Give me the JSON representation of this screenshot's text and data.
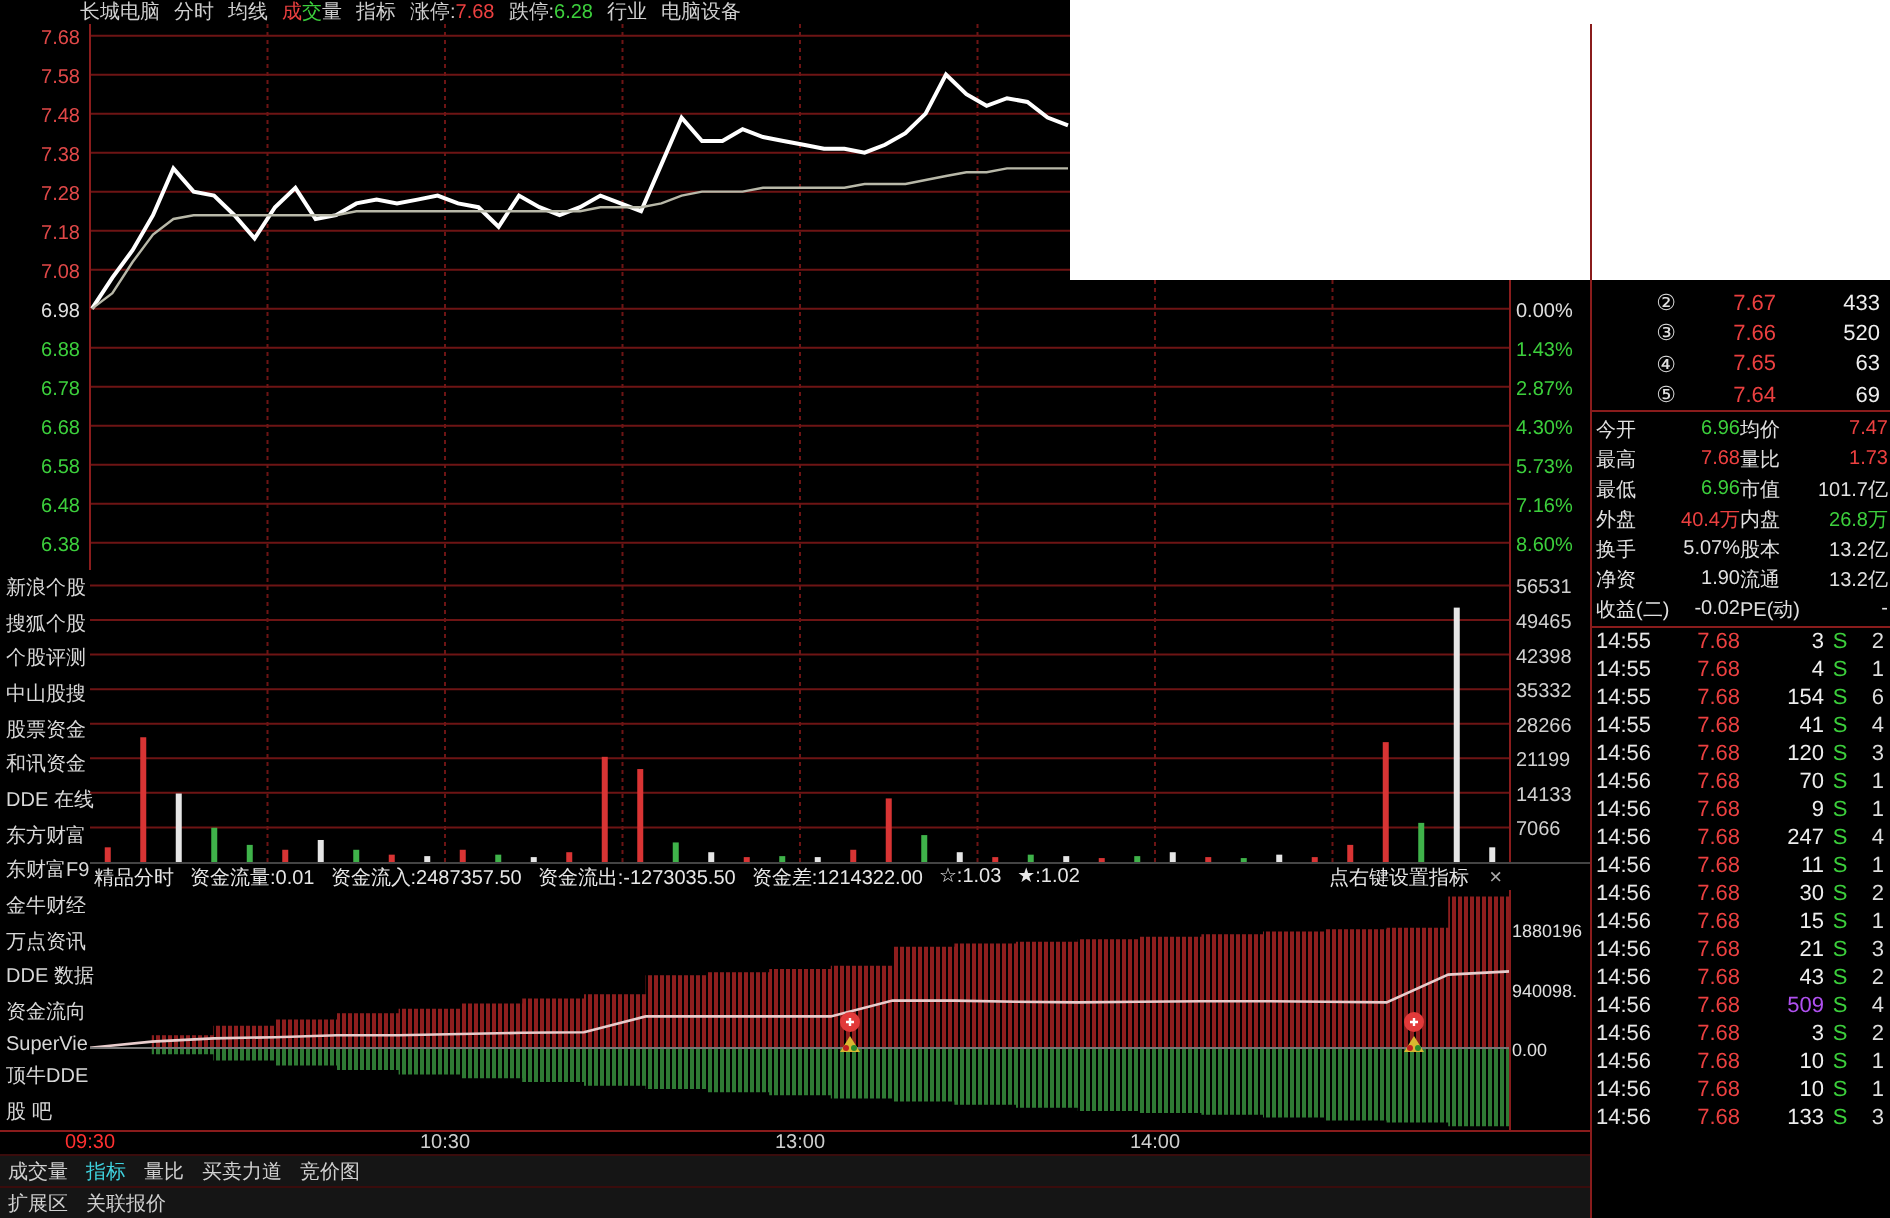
{
  "title_bar": [
    {
      "kind": "label",
      "text": "长城电脑"
    },
    {
      "kind": "menu",
      "text": "分时"
    },
    {
      "kind": "menu",
      "text": "均线"
    },
    {
      "kind": "indicator",
      "segments": [
        {
          "text": "成",
          "color": "#ec4040"
        },
        {
          "text": "交",
          "color": "#3ccf3c"
        },
        {
          "text": "量",
          "color": "#d0d0d0"
        }
      ]
    },
    {
      "kind": "menu",
      "text": "指标"
    },
    {
      "kind": "limit",
      "text": "涨停:",
      "value": "7.68",
      "color": "#ec4040"
    },
    {
      "kind": "limit",
      "text": "跌停:",
      "value": "6.28",
      "color": "#3ccf3c"
    },
    {
      "kind": "label",
      "text": "行业"
    },
    {
      "kind": "label",
      "text": "电脑设备"
    }
  ],
  "price_chart": {
    "chart_data": {
      "type": "line",
      "grid": true,
      "ylim": [
        6.31,
        7.71
      ],
      "yticks": [
        7.68,
        7.58,
        7.48,
        7.38,
        7.28,
        7.18,
        7.08,
        6.98,
        6.88,
        6.78,
        6.68,
        6.58,
        6.48,
        6.38
      ],
      "series": [
        {
          "color": "#ffffff",
          "values": [
            6.98,
            7.06,
            7.13,
            7.22,
            7.34,
            7.28,
            7.27,
            7.22,
            7.16,
            7.24,
            7.29,
            7.21,
            7.22,
            7.25,
            7.26,
            7.25,
            7.26,
            7.27,
            7.25,
            7.24,
            7.19,
            7.27,
            7.24,
            7.22,
            7.24,
            7.27,
            7.25,
            7.23,
            7.35,
            7.47,
            7.41,
            7.41,
            7.44,
            7.42,
            7.41,
            7.4,
            7.39,
            7.39,
            7.38,
            7.4,
            7.43,
            7.48,
            7.58,
            7.53,
            7.5,
            7.52,
            7.51,
            7.47,
            7.45
          ]
        },
        {
          "color": "#b8b8a8",
          "values": [
            6.98,
            7.02,
            7.1,
            7.17,
            7.21,
            7.22,
            7.22,
            7.22,
            7.22,
            7.22,
            7.22,
            7.22,
            7.22,
            7.23,
            7.23,
            7.23,
            7.23,
            7.23,
            7.23,
            7.23,
            7.23,
            7.23,
            7.23,
            7.23,
            7.23,
            7.24,
            7.24,
            7.24,
            7.25,
            7.27,
            7.28,
            7.28,
            7.28,
            7.29,
            7.29,
            7.29,
            7.29,
            7.29,
            7.3,
            7.3,
            7.3,
            7.31,
            7.32,
            7.33,
            7.33,
            7.34,
            7.34,
            7.34,
            7.34
          ]
        }
      ]
    },
    "percent_axis": [
      {
        "text": "0.00%",
        "color": "#e0e0e0"
      },
      {
        "text": "1.43%",
        "color": "#3ccf3c"
      },
      {
        "text": "2.87%",
        "color": "#3ccf3c"
      },
      {
        "text": "4.30%",
        "color": "#3ccf3c"
      },
      {
        "text": "5.73%",
        "color": "#3ccf3c"
      },
      {
        "text": "7.16%",
        "color": "#3ccf3c"
      },
      {
        "text": "8.60%",
        "color": "#3ccf3c"
      }
    ]
  },
  "side_links": [
    "新浪个股",
    "搜狐个股",
    "个股评测",
    "中山股搜",
    "股票资金",
    "和讯资金",
    "DDE 在线",
    "东方财富",
    "东财富F9",
    "金牛财经",
    "万点资讯",
    "DDE 数据",
    "资金流向",
    "SuperVie",
    "顶牛DDE",
    "股 吧"
  ],
  "volume_chart": {
    "chart_data": {
      "type": "bar",
      "grid": true,
      "ylim": [
        0,
        59690
      ],
      "yticks": [
        56531,
        49465,
        42398,
        35332,
        28266,
        21199,
        14133,
        7066
      ],
      "series": [
        {
          "color": "#d93434",
          "values": [
            3000,
            25500,
            null,
            null,
            null,
            2500,
            null,
            null,
            1500,
            null,
            2500,
            null,
            null,
            2000,
            21500,
            19000,
            null,
            null,
            1000,
            null,
            null,
            2500,
            13000,
            null,
            null,
            1000,
            null,
            null,
            800,
            null,
            null,
            1000,
            null,
            null,
            1000,
            3500,
            24500,
            null,
            null,
            null
          ]
        },
        {
          "color": "#3fb34a",
          "values": [
            null,
            null,
            null,
            7000,
            3500,
            null,
            null,
            2500,
            null,
            null,
            null,
            1500,
            null,
            null,
            null,
            null,
            4000,
            null,
            null,
            1200,
            null,
            null,
            null,
            5500,
            null,
            null,
            1500,
            null,
            null,
            1200,
            null,
            null,
            800,
            null,
            null,
            null,
            null,
            8000,
            null,
            null
          ]
        },
        {
          "color": "#e6e6e6",
          "values": [
            null,
            null,
            14000,
            null,
            null,
            null,
            4500,
            null,
            null,
            1200,
            null,
            null,
            1000,
            null,
            null,
            null,
            null,
            2000,
            null,
            null,
            1000,
            null,
            null,
            null,
            2000,
            null,
            null,
            1200,
            null,
            null,
            2000,
            null,
            null,
            1500,
            null,
            null,
            null,
            null,
            52000,
            3000
          ]
        }
      ]
    }
  },
  "flow_panel": {
    "title": "精品分时",
    "stats": [
      "资金流量:0.01",
      "资金流入:2487357.50",
      "资金流出:-1273035.50",
      "资金差:1214322.00",
      "☆:1.03",
      "★:1.02"
    ],
    "hint": "点右键设置指标",
    "close": "×",
    "chart_data": {
      "type": "area",
      "ylim": [
        -1300000,
        2500000
      ],
      "yticks": [
        {
          "value": 1880196,
          "label": "1880196"
        },
        {
          "value": 940098,
          "label": "940098."
        },
        {
          "value": 0,
          "label": "0.00"
        }
      ],
      "series": [
        {
          "color": "#8e1e1e",
          "values": [
            0,
            200000,
            350000,
            450000,
            550000,
            620000,
            700000,
            780000,
            850000,
            1150000,
            1200000,
            1250000,
            1300000,
            1600000,
            1650000,
            1680000,
            1720000,
            1760000,
            1800000,
            1840000,
            1880000,
            1900000,
            2400000,
            2490000
          ]
        },
        {
          "color": "#2f7a34",
          "values": [
            0,
            -100000,
            -200000,
            -280000,
            -350000,
            -420000,
            -480000,
            -540000,
            -600000,
            -650000,
            -700000,
            -750000,
            -800000,
            -850000,
            -900000,
            -950000,
            -1000000,
            -1030000,
            -1060000,
            -1100000,
            -1150000,
            -1180000,
            -1240000,
            -1270000
          ]
        },
        {
          "type": "line",
          "color": "#e8cccc",
          "values": [
            0,
            100000,
            150000,
            170000,
            200000,
            200000,
            220000,
            240000,
            250000,
            500000,
            500000,
            500000,
            500000,
            750000,
            750000,
            730000,
            720000,
            730000,
            740000,
            740000,
            730000,
            720000,
            1160000,
            1210000
          ]
        }
      ]
    }
  },
  "time_axis": [
    {
      "text": "09:30",
      "highlighted": true
    },
    {
      "text": "10:30",
      "highlighted": false
    },
    {
      "text": "13:00",
      "highlighted": false
    },
    {
      "text": "14:00",
      "highlighted": false
    }
  ],
  "bottom_tabs": [
    [
      {
        "label": "成交量",
        "selected": false
      },
      {
        "label": "指标",
        "selected": true
      },
      {
        "label": "量比",
        "selected": false
      },
      {
        "label": "买卖力道",
        "selected": false
      },
      {
        "label": "竞价图",
        "selected": false
      }
    ],
    [
      {
        "label": "扩展区",
        "selected": false
      },
      {
        "label": "关联报价",
        "selected": false
      }
    ]
  ],
  "order_book": [
    {
      "rank": "②",
      "price": "7.67",
      "volume": "433"
    },
    {
      "rank": "③",
      "price": "7.66",
      "volume": "520"
    },
    {
      "rank": "④",
      "price": "7.65",
      "volume": "63"
    },
    {
      "rank": "⑤",
      "price": "7.64",
      "volume": "69"
    }
  ],
  "stats": [
    {
      "label": "今开",
      "value": "6.96",
      "color": "#3ccf3c"
    },
    {
      "label": "均价",
      "value": "7.47",
      "color": "#ec4040"
    },
    {
      "label": "最高",
      "value": "7.68",
      "color": "#ec4040"
    },
    {
      "label": "量比",
      "value": "1.73",
      "color": "#ec4040"
    },
    {
      "label": "最低",
      "value": "6.96",
      "color": "#3ccf3c"
    },
    {
      "label": "市值",
      "value": "101.7亿",
      "color": "#e0e0e0"
    },
    {
      "label": "外盘",
      "value": "40.4万",
      "color": "#ec4040"
    },
    {
      "label": "内盘",
      "value": "26.8万",
      "color": "#3ccf3c"
    },
    {
      "label": "换手",
      "value": "5.07%",
      "color": "#e0e0e0"
    },
    {
      "label": "股本",
      "value": "13.2亿",
      "color": "#e0e0e0"
    },
    {
      "label": "净资",
      "value": "1.90",
      "color": "#e0e0e0"
    },
    {
      "label": "流通",
      "value": "13.2亿",
      "color": "#e0e0e0"
    },
    {
      "label": "收益(二)",
      "value": "-0.02",
      "color": "#e0e0e0"
    },
    {
      "label": "PE(动)",
      "value": "-",
      "color": "#e0e0e0"
    }
  ],
  "trades": [
    {
      "time": "14:55",
      "price": "7.68",
      "volume": "3",
      "side": "S",
      "column_5": "2",
      "large": false
    },
    {
      "time": "14:55",
      "price": "7.68",
      "volume": "4",
      "side": "S",
      "column_5": "1",
      "large": false
    },
    {
      "time": "14:55",
      "price": "7.68",
      "volume": "154",
      "side": "S",
      "column_5": "6",
      "large": false
    },
    {
      "time": "14:55",
      "price": "7.68",
      "volume": "41",
      "side": "S",
      "column_5": "4",
      "large": false
    },
    {
      "time": "14:56",
      "price": "7.68",
      "volume": "120",
      "side": "S",
      "column_5": "3",
      "large": false
    },
    {
      "time": "14:56",
      "price": "7.68",
      "volume": "70",
      "side": "S",
      "column_5": "1",
      "large": false
    },
    {
      "time": "14:56",
      "price": "7.68",
      "volume": "9",
      "side": "S",
      "column_5": "1",
      "large": false
    },
    {
      "time": "14:56",
      "price": "7.68",
      "volume": "247",
      "side": "S",
      "column_5": "4",
      "large": false
    },
    {
      "time": "14:56",
      "price": "7.68",
      "volume": "11",
      "side": "S",
      "column_5": "1",
      "large": false
    },
    {
      "time": "14:56",
      "price": "7.68",
      "volume": "30",
      "side": "S",
      "column_5": "2",
      "large": false
    },
    {
      "time": "14:56",
      "price": "7.68",
      "volume": "15",
      "side": "S",
      "column_5": "1",
      "large": false
    },
    {
      "time": "14:56",
      "price": "7.68",
      "volume": "21",
      "side": "S",
      "column_5": "3",
      "large": false
    },
    {
      "time": "14:56",
      "price": "7.68",
      "volume": "43",
      "side": "S",
      "column_5": "2",
      "large": false
    },
    {
      "time": "14:56",
      "price": "7.68",
      "volume": "509",
      "side": "S",
      "column_5": "4",
      "large": true
    },
    {
      "time": "14:56",
      "price": "7.68",
      "volume": "3",
      "side": "S",
      "column_5": "2",
      "large": false
    },
    {
      "time": "14:56",
      "price": "7.68",
      "volume": "10",
      "side": "S",
      "column_5": "1",
      "large": false
    },
    {
      "time": "14:56",
      "price": "7.68",
      "volume": "10",
      "side": "S",
      "column_5": "1",
      "large": false
    },
    {
      "time": "14:56",
      "price": "7.68",
      "volume": "133",
      "side": "S",
      "column_5": "3",
      "large": false
    }
  ]
}
